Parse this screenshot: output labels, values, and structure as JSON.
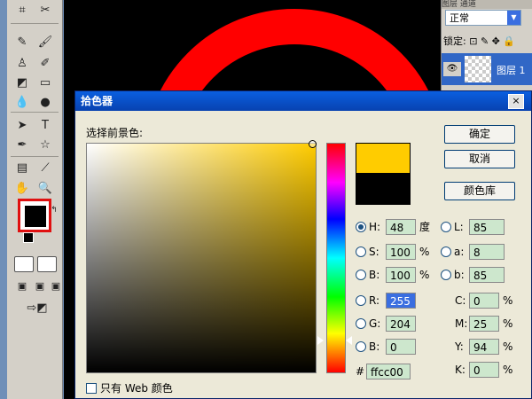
{
  "layers_panel": {
    "tabs": "图层  通道",
    "blend_mode": "正常",
    "lock_label": "锁定:",
    "layer_name": "图层 1"
  },
  "dialog": {
    "title": "拾色器",
    "close_label": "×",
    "picker_label": "选择前景色:",
    "buttons": {
      "ok": "确定",
      "cancel": "取消",
      "library": "颜色库"
    },
    "current_color": "#ffcc00",
    "previous_color": "#000000",
    "hsb": {
      "h_label": "H:",
      "h": "48",
      "h_unit": "度",
      "s_label": "S:",
      "s": "100",
      "s_unit": "%",
      "b_label": "B:",
      "b": "100",
      "b_unit": "%",
      "selected": "H"
    },
    "lab": {
      "l_label": "L:",
      "l": "85",
      "a_label": "a:",
      "a": "8",
      "b_label": "b:",
      "b": "85"
    },
    "rgb": {
      "r_label": "R:",
      "r": "255",
      "g_label": "G:",
      "g": "204",
      "b_label": "B:",
      "b": "0"
    },
    "cmyk": {
      "c_label": "C:",
      "c": "0",
      "m_label": "M:",
      "m": "25",
      "y_label": "Y:",
      "y": "94",
      "k_label": "K:",
      "k": "0",
      "unit": "%"
    },
    "hex_label": "#",
    "hex": "ffcc00",
    "web_only_label": "只有 Web 颜色"
  }
}
